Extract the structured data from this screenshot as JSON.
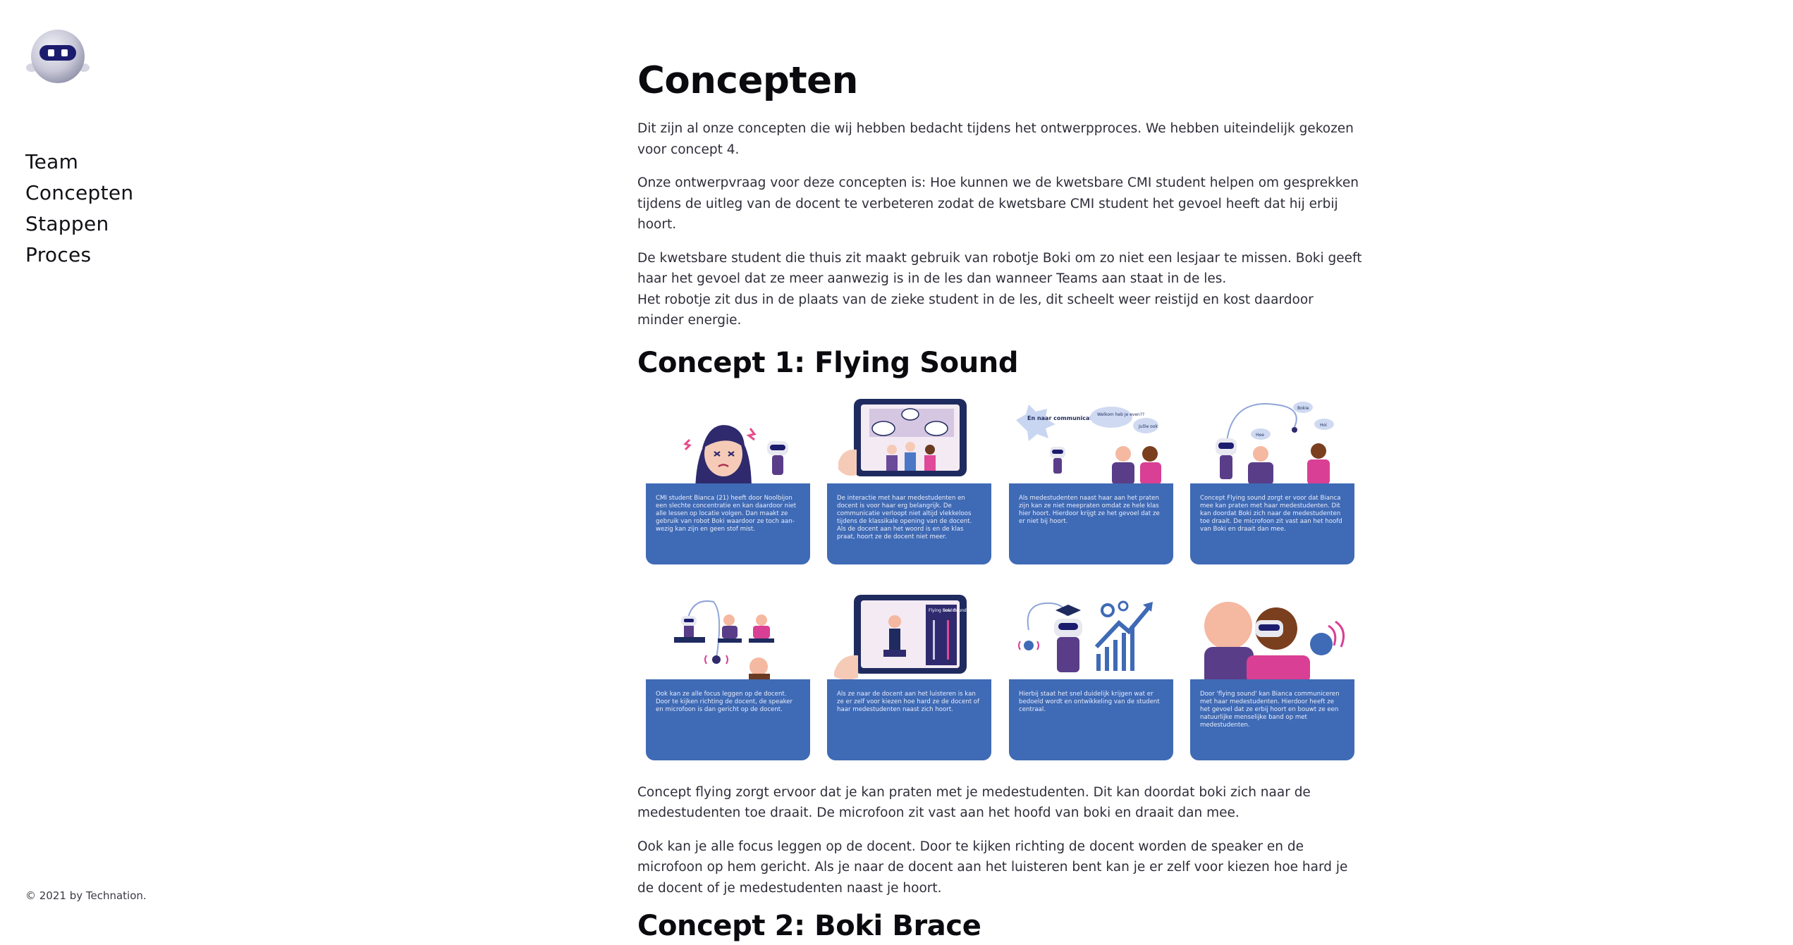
{
  "sidebar": {
    "logo_icon": "robot-boki-logo-icon",
    "nav": [
      "Team",
      "Concepten",
      "Stappen",
      "Proces"
    ],
    "footer": "© 2021 by Technation."
  },
  "main": {
    "title": "Concepten",
    "intro": [
      "Dit zijn al onze concepten die wij hebben bedacht tijdens het ontwerpproces. We hebben uiteindelijk gekozen voor concept 4.",
      "Onze ontwerpvraag voor deze concepten is: Hoe kunnen we de kwetsbare CMI student helpen om gesprekken tijdens de uitleg van de docent te verbeteren zodat de kwetsbare CMI student het gevoel heeft dat hij erbij hoort.",
      "De kwetsbare student die thuis zit maakt gebruik van robotje Boki om zo niet een lesjaar te missen. Boki geeft haar het gevoel dat ze meer aanwezig is in de les dan wanneer Teams aan staat in de les.",
      "Het robotje zit dus in de plaats van de zieke student in de les, dit scheelt weer reistijd en kost daardoor minder energie."
    ],
    "concept1": {
      "title": "Concept 1: Flying Sound",
      "storyboard": {
        "caption_color": "#3f6ab5",
        "panels": [
          {
            "text": "CMI student Bianca (21) heeft door Noolbijon een slechte concentratie en kan daardoor niet alle lessen op locatie volgen. Dan maakt ze gebruik van robot Boki waardoor ze toch aan-wezig kan zijn en geen stof mist.",
            "labels": []
          },
          {
            "text": "De interactie met haar medestudenten en docent is voor haar erg belangrijk. De communicatie verloopt niet altijd vlekkeloos tijdens de klassikale opening van de docent. Als de docent aan het woord is en de klas praat, hoort ze de docent niet meer.",
            "labels": []
          },
          {
            "text": "Als medestudenten naast haar aan het praten zijn kan ze niet meepraten omdat ze hele klas hier hoort. Hierdoor krijgt ze het gevoel dat ze er niet bij hoort.",
            "labels": [
              "En naar communicatie?",
              "Welkom heb je even??",
              "Jullie ook"
            ]
          },
          {
            "text": "Concept Flying sound zorgt er voor dat Bianca mee kan praten met haar medestudenten. Dit kan doordat Boki zich naar de medestudenten toe draait. De microfoon zit vast aan het hoofd van Boki en draait dan mee.",
            "labels": [
              "Bokie",
              "Hee",
              "Hoi"
            ]
          },
          {
            "text": "Ook kan ze alle focus leggen op de docent. Door te kijken richting de docent, de speaker en microfoon is dan gericht op de docent.",
            "labels": []
          },
          {
            "text": "Als ze naar de docent aan het luisteren is kan ze er zelf voor kiezen hoe hard ze de docent of haar medestudenten naast zich hoort.",
            "labels": [
              "Flying Sound",
              "Boki Sound"
            ]
          },
          {
            "text": "Hierbij staat het snel duidelijk krijgen wat er bedoeld wordt en ontwikkeling van de student centraal.",
            "labels": []
          },
          {
            "text": "Door 'flying sound' kan Bianca communiceren met haar medestudenten. Hierdoor heeft ze het gevoel dat ze erbij hoort en bouwt ze een natuurlijke menselijke band op met medestudenten.",
            "labels": []
          }
        ]
      },
      "paragraphs": [
        "Concept flying zorgt ervoor dat je kan praten met je medestudenten. Dit kan doordat boki zich naar de medestudenten toe draait. De microfoon zit vast aan het hoofd van boki en draait dan mee.",
        "Ook kan je alle focus leggen op de docent. Door te kijken richting de docent worden de speaker en de microfoon op hem gericht. Als je naar de docent aan het luisteren bent kan je er zelf voor kiezen hoe hard je de docent of je medestudenten naast je hoort."
      ]
    },
    "concept2": {
      "title": "Concept 2: Boki Brace"
    }
  }
}
